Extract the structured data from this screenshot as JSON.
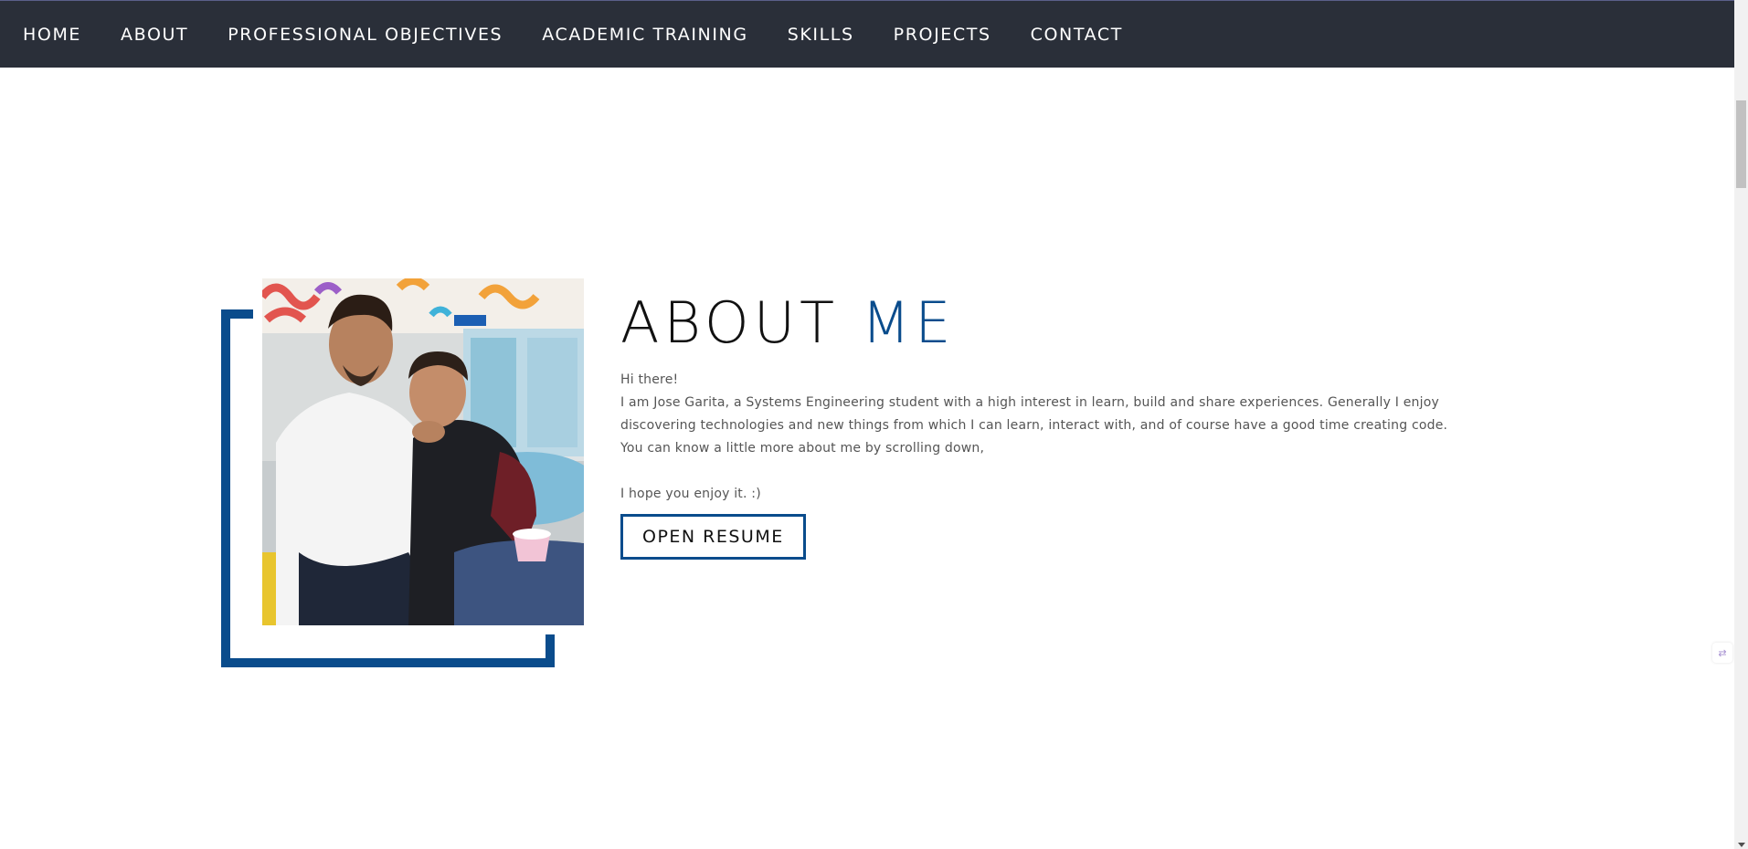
{
  "nav": {
    "items": [
      {
        "label": "HOME"
      },
      {
        "label": "ABOUT"
      },
      {
        "label": "PROFESSIONAL OBJECTIVES"
      },
      {
        "label": "ACADEMIC TRAINING"
      },
      {
        "label": "SKILLS"
      },
      {
        "label": "PROJECTS"
      },
      {
        "label": "CONTACT"
      }
    ]
  },
  "about": {
    "title_main": "ABOUT",
    "title_accent": "ME",
    "greeting": "Hi there!",
    "paragraph_line1": "I am Jose Garita, a Systems Engineering student with a high interest in learn, build and share experiences. Generally I enjoy",
    "paragraph_line2": "discovering technologies and new things from which I can learn, interact with, and of course have a good time creating code.",
    "paragraph_line3": "You can know a little more about me by scrolling down,",
    "closing": "I hope you enjoy it. :)",
    "resume_button": "OPEN RESUME"
  },
  "colors": {
    "navbar_bg": "#2a2f39",
    "accent": "#0a4c8c",
    "text_dark": "#111111",
    "text_body": "#555555"
  },
  "icons": {
    "floating_widget": "translate-icon"
  }
}
